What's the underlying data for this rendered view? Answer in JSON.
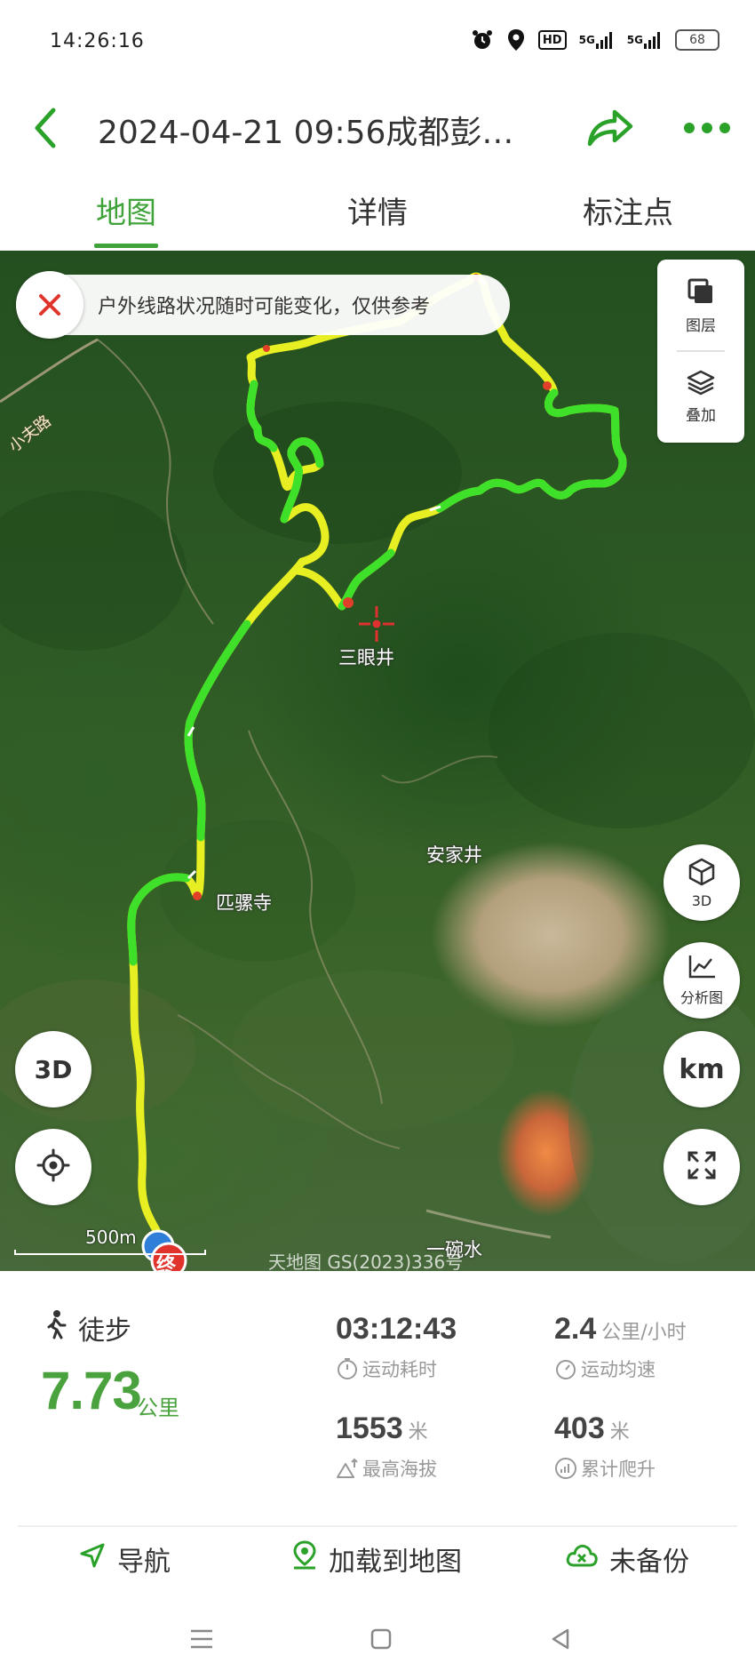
{
  "status_bar": {
    "time": "14:26:16",
    "hd_label": "HD",
    "signal_1": "5G",
    "signal_2": "5G",
    "battery": "68",
    "icons": [
      "alarm-icon",
      "location-icon",
      "hd-icon",
      "signal-icon",
      "signal-icon",
      "battery-icon"
    ]
  },
  "header": {
    "title": "2024-04-21 09:56成都彭…",
    "icons": [
      "back-arrow-icon",
      "share-icon",
      "more-icon"
    ]
  },
  "tabs": [
    {
      "label": "地图",
      "active": true
    },
    {
      "label": "详情",
      "active": false
    },
    {
      "label": "标注点",
      "active": false
    }
  ],
  "map": {
    "notice": "户外线路状况随时可能变化，仅供参考",
    "layer_panel": [
      {
        "label": "图层",
        "icon": "layers-square-icon"
      },
      {
        "label": "叠加",
        "icon": "stack-icon"
      }
    ],
    "place_labels": [
      "三眼井",
      "安家井",
      "匹骡寺",
      "小夫路",
      "一碗水"
    ],
    "scale_label": "500m",
    "watermark": "天地图 GS(2023)336号",
    "buttons": {
      "view_3d": "3D",
      "analysis": "分析图",
      "km": "km",
      "left_3d": "3D"
    },
    "end_marker": "终",
    "track_colors": {
      "fast": "#33e022",
      "medium": "#e6f020",
      "slow": "#e0402a"
    }
  },
  "stats": {
    "activity": "徒步",
    "distance_value": "7.73",
    "distance_unit": "公里",
    "duration_value": "03:12:43",
    "duration_label": "运动耗时",
    "speed_value": "2.4",
    "speed_unit": "公里/小时",
    "speed_label": "运动均速",
    "max_alt_value": "1553",
    "max_alt_unit": "米",
    "max_alt_label": "最高海拔",
    "climb_value": "403",
    "climb_unit": "米",
    "climb_label": "累计爬升"
  },
  "actions": [
    {
      "label": "导航",
      "icon": "navigate-icon"
    },
    {
      "label": "加载到地图",
      "icon": "map-pin-icon"
    },
    {
      "label": "未备份",
      "icon": "cloud-icon"
    }
  ],
  "colors": {
    "accent": "#3fa33a",
    "text": "#333333",
    "muted": "#999999"
  }
}
